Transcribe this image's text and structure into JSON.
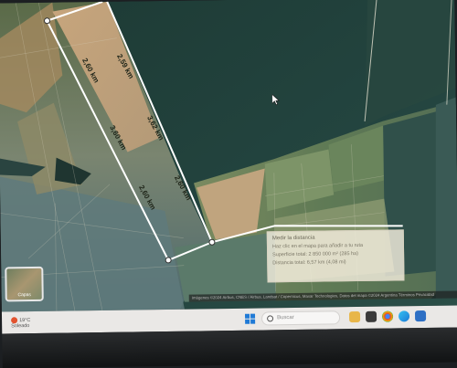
{
  "map": {
    "distance_labels": [
      "2,60 km",
      "2,59 km",
      "3,60 km",
      "3,62 km",
      "2,60 km",
      "2,60 km"
    ]
  },
  "measure_panel": {
    "title": "Medir la distancia",
    "line1": "Haz clic en el mapa para añadir a tu ruta",
    "line2": "Superficie total: 2 850 000 m² (285 ha)",
    "line3": "Distancia total: 6,57 km (4,08 mi)"
  },
  "layers": {
    "label": "Capas"
  },
  "attribution": {
    "text": "Imágenes ©2024 Airbus, CNES / Airbus, Landsat / Copernicus, Maxar Technologies, Datos del mapa ©2024    Argentina   Términos   Privacidad"
  },
  "taskbar": {
    "weather_temp": "19°C",
    "weather_desc": "Soleado",
    "search_placeholder": "Buscar",
    "apps": [
      "file-explorer-icon",
      "store-icon",
      "chrome-icon",
      "edge-icon",
      "mail-icon"
    ]
  },
  "colors": {
    "selection_outline": "#ffffff",
    "map_water": "#23443f",
    "taskbar": "#eae8e6",
    "windows_accent": "#1f7ad6"
  }
}
